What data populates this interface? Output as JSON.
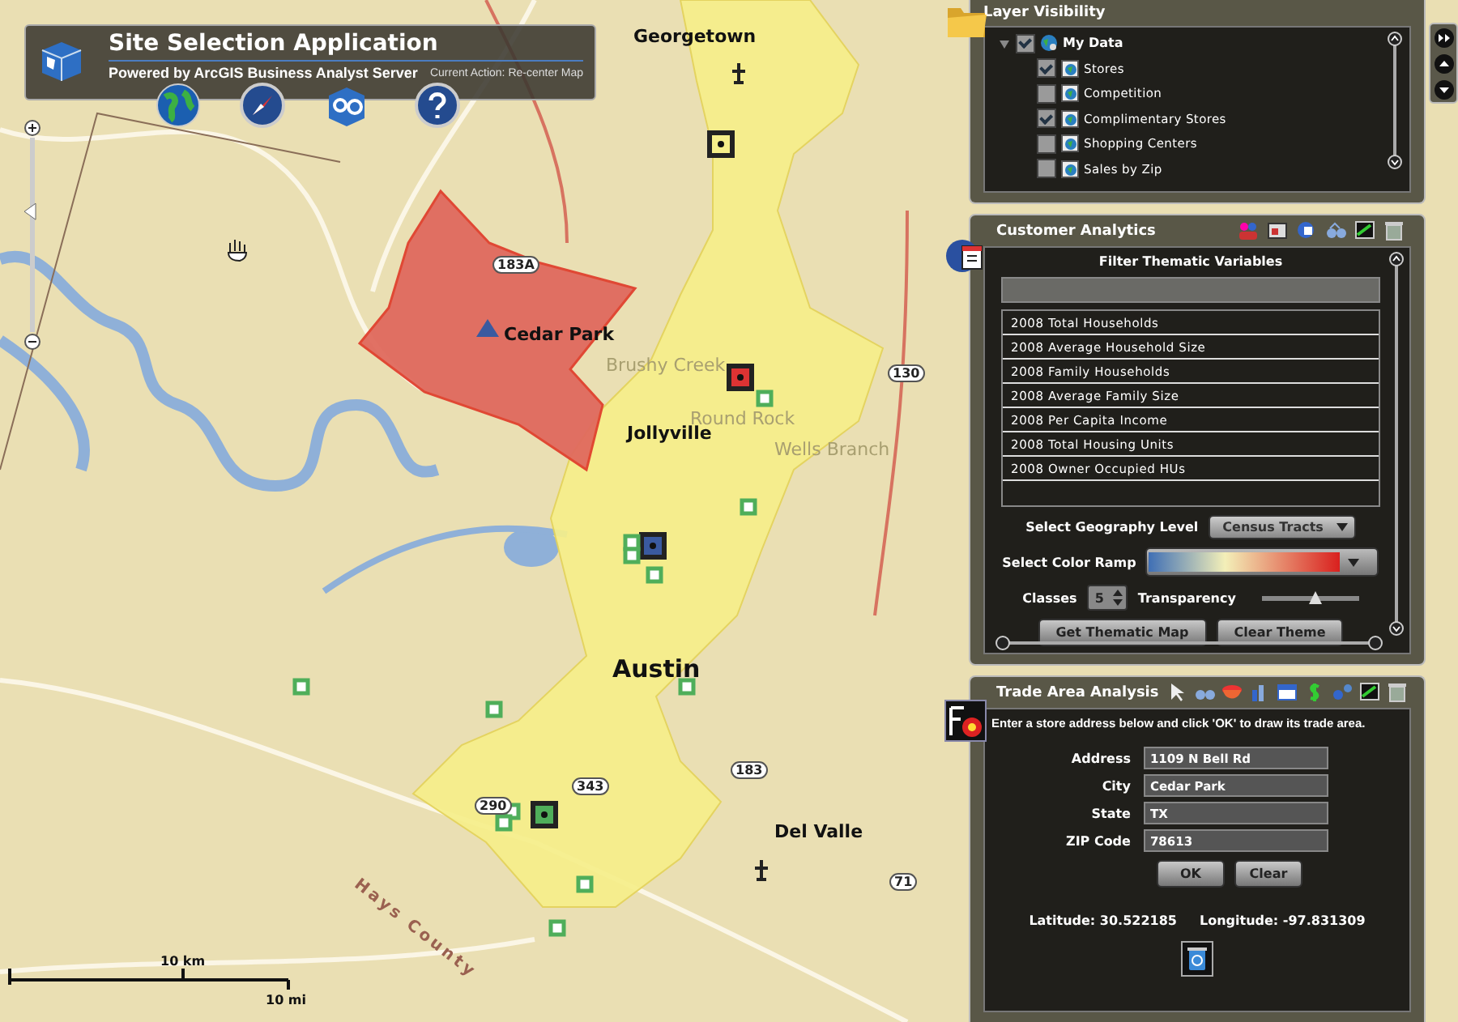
{
  "header": {
    "title": "Site Selection Application",
    "subtitle": "Powered by ArcGIS Business Analyst Server",
    "current_action": "Current Action: Re-center Map"
  },
  "map": {
    "labels": [
      {
        "text": "Georgetown",
        "kind": "place"
      },
      {
        "text": "Cedar Park",
        "kind": "place"
      },
      {
        "text": "Brushy Creek",
        "kind": "faint"
      },
      {
        "text": "Round Rock",
        "kind": "faint"
      },
      {
        "text": "Jollyville",
        "kind": "place"
      },
      {
        "text": "Wells Branch",
        "kind": "faint"
      },
      {
        "text": "Austin",
        "kind": "city"
      },
      {
        "text": "Del Valle",
        "kind": "place"
      },
      {
        "text": "Hays County",
        "kind": "county"
      },
      {
        "text": "183A",
        "kind": "shield"
      },
      {
        "text": "130",
        "kind": "shield"
      },
      {
        "text": "183",
        "kind": "shield"
      },
      {
        "text": "71",
        "kind": "shield"
      },
      {
        "text": "343",
        "kind": "shield"
      },
      {
        "text": "290",
        "kind": "shield"
      }
    ],
    "scale_bar": {
      "km": "10 km",
      "mi": "10 mi"
    },
    "zoom_slider": {
      "level": 0.62
    }
  },
  "layer_visibility": {
    "title": "Layer Visibility",
    "group": {
      "label": "My Data",
      "expanded": true,
      "checked": true,
      "children": [
        {
          "label": "Stores",
          "checked": true
        },
        {
          "label": "Competition",
          "checked": false
        },
        {
          "label": "Complimentary Stores",
          "checked": true
        },
        {
          "label": "Shopping Centers",
          "checked": false
        },
        {
          "label": "Sales by Zip",
          "checked": false
        }
      ]
    }
  },
  "customer_analytics": {
    "title": "Customer Analytics",
    "filter_title": "Filter Thematic Variables",
    "variables": [
      "2008 Total Households",
      "2008 Average Household Size",
      "2008 Family Households",
      "2008 Average Family Size",
      "2008 Per Capita Income",
      "2008 Total Housing Units",
      "2008 Owner Occupied HUs"
    ],
    "geography_label": "Select Geography Level",
    "geography_value": "Census Tracts",
    "color_ramp_label": "Select Color Ramp",
    "classes_label": "Classes",
    "classes_value": "5",
    "transparency_label": "Transparency",
    "transparency": {
      "level": 0.55
    },
    "buttons": [
      "Get Thematic Map",
      "Clear Theme"
    ]
  },
  "trade_area": {
    "title": "Trade Area Analysis",
    "instruction": "Enter a store address below and click 'OK' to draw its trade area.",
    "fields": [
      {
        "label": "Address",
        "value": "1109 N Bell Rd"
      },
      {
        "label": "City",
        "value": "Cedar Park"
      },
      {
        "label": "State",
        "value": "TX"
      },
      {
        "label": "ZIP Code",
        "value": "78613"
      }
    ],
    "buttons": [
      "OK",
      "Clear"
    ],
    "latitude": "Latitude: 30.522185",
    "longitude": "Longitude: -97.831309"
  }
}
